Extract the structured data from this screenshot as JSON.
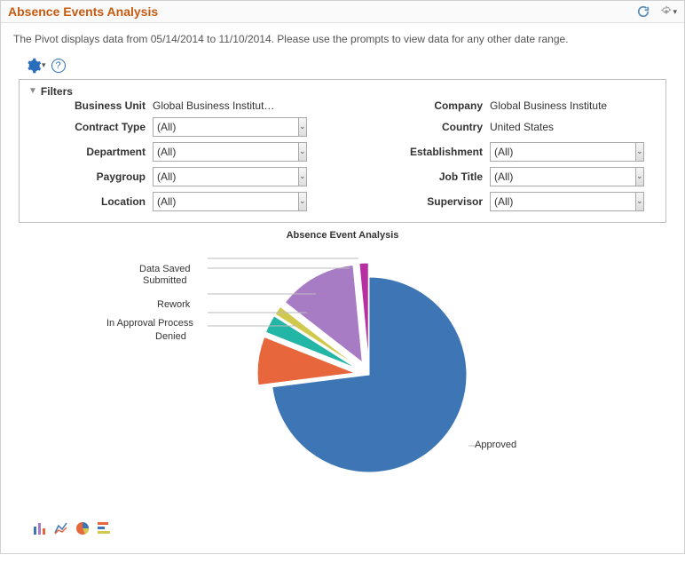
{
  "header": {
    "title": "Absence Events Analysis"
  },
  "description": "The Pivot displays data from 05/14/2014 to 11/10/2014. Please use the prompts to view data for any other date range.",
  "icons": {
    "help": "?"
  },
  "filters": {
    "title": "Filters",
    "left": {
      "business_unit": {
        "label": "Business Unit",
        "value": "Global Business Institut…"
      },
      "contract_type": {
        "label": "Contract Type",
        "value": "(All)"
      },
      "department": {
        "label": "Department",
        "value": "(All)"
      },
      "paygroup": {
        "label": "Paygroup",
        "value": "(All)"
      },
      "location": {
        "label": "Location",
        "value": "(All)"
      }
    },
    "right": {
      "company": {
        "label": "Company",
        "value": "Global Business Institute"
      },
      "country": {
        "label": "Country",
        "value": "United States"
      },
      "establishment": {
        "label": "Establishment",
        "value": "(All)"
      },
      "job_title": {
        "label": "Job Title",
        "value": "(All)"
      },
      "supervisor": {
        "label": "Supervisor",
        "value": "(All)"
      }
    }
  },
  "chart_data": {
    "type": "pie",
    "title": "Absence Event Analysis",
    "series": [
      {
        "name": "Approved",
        "value": 73,
        "color": "#3e76b5"
      },
      {
        "name": "Denied",
        "value": 8,
        "color": "#e8663c"
      },
      {
        "name": "In Approval Process",
        "value": 3,
        "color": "#23b5a5"
      },
      {
        "name": "Rework",
        "value": 1.5,
        "color": "#d1c94d"
      },
      {
        "name": "Submitted",
        "value": 13,
        "color": "#a77cc4"
      },
      {
        "name": "Data Saved",
        "value": 1.5,
        "color": "#b82fa2"
      }
    ],
    "start_angle": -90,
    "exploded_start_index": 1,
    "exploded_end_index": 5
  },
  "labels": {
    "approved": "Approved",
    "denied": "Denied",
    "in_approval": "In Approval Process",
    "rework": "Rework",
    "submitted": "Submitted",
    "data_saved": "Data Saved"
  }
}
